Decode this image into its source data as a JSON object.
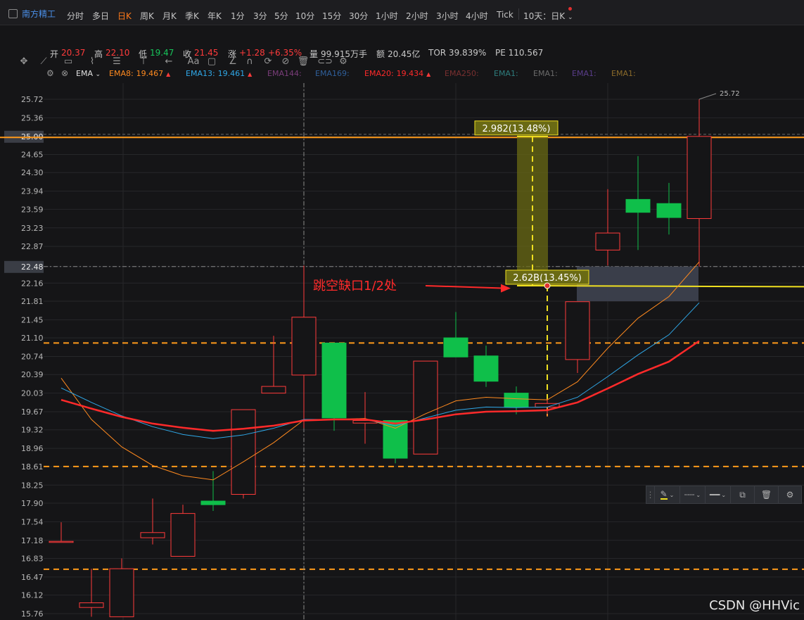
{
  "stock": {
    "name": "南方精工"
  },
  "timeframes": [
    "分时",
    "多日",
    "日K",
    "周K",
    "月K",
    "季K",
    "年K",
    "1分",
    "3分",
    "5分",
    "10分",
    "15分",
    "30分",
    "1小时",
    "2小时",
    "3小时",
    "4小时",
    "Tick"
  ],
  "active_timeframe": "日K",
  "period_select": "10天：日K",
  "quote": {
    "open_label": "开",
    "open": "20.37",
    "high_label": "高",
    "high": "22.10",
    "low_label": "低",
    "low": "19.47",
    "close_label": "收",
    "close": "21.45",
    "chg_label": "涨",
    "chg": "+1.28",
    "chg_pct": "+6.35%",
    "vol_label": "量",
    "vol": "99.915万手",
    "amt_label": "额",
    "amt": "20.45亿",
    "tor": "TOR 39.839%",
    "pe": "PE 110.567"
  },
  "ema": {
    "name": "EMA",
    "items": [
      {
        "label": "EMA8:",
        "value": "19.467",
        "color": "#ff8a1f",
        "arrow": "▲"
      },
      {
        "label": "EMA13:",
        "value": "19.461",
        "color": "#2fa8e8",
        "arrow": "▲"
      },
      {
        "label": "EMA144:",
        "value": "",
        "color": "#7a3d7a",
        "arrow": ""
      },
      {
        "label": "EMA169:",
        "value": "",
        "color": "#2f5f9a",
        "arrow": ""
      },
      {
        "label": "EMA20:",
        "value": "19.434",
        "color": "#ff2a2a",
        "arrow": "▲"
      },
      {
        "label": "EMA250:",
        "value": "",
        "color": "#7a3030",
        "arrow": ""
      },
      {
        "label": "EMA1:",
        "value": "",
        "color": "#2e7d7d",
        "arrow": ""
      },
      {
        "label": "EMA1:",
        "value": "",
        "color": "#6a6a6a",
        "arrow": ""
      },
      {
        "label": "EMA1:",
        "value": "",
        "color": "#5a3d8a",
        "arrow": ""
      },
      {
        "label": "EMA1:",
        "value": "",
        "color": "#8a6a2a",
        "arrow": ""
      }
    ]
  },
  "chart": {
    "price_ticks": [
      "25.72",
      "25.36",
      "25.00",
      "24.65",
      "24.30",
      "23.94",
      "23.59",
      "23.23",
      "22.87",
      "22.48",
      "22.16",
      "21.81",
      "21.45",
      "21.10",
      "20.74",
      "20.39",
      "20.03",
      "19.67",
      "19.32",
      "18.96",
      "18.61",
      "18.25",
      "17.90",
      "17.54",
      "17.18",
      "16.83",
      "16.47",
      "16.12",
      "15.76"
    ],
    "highlight_ticks": [
      "25.00",
      "22.48"
    ],
    "high_marker": "25.72",
    "measure_top_label": "2.982(13.48%)",
    "measure_bottom_label": "2.62B(13.45%)",
    "annotation": "跳空缺口1/2处",
    "colors": {
      "up": "#ff3b3b",
      "down": "#0fbf4a",
      "bg": "#151517",
      "dash_orange": "#ff9a1a",
      "yellow": "#f0e020"
    }
  },
  "float_toolbar": {},
  "watermark": "CSDN @HHVic"
}
